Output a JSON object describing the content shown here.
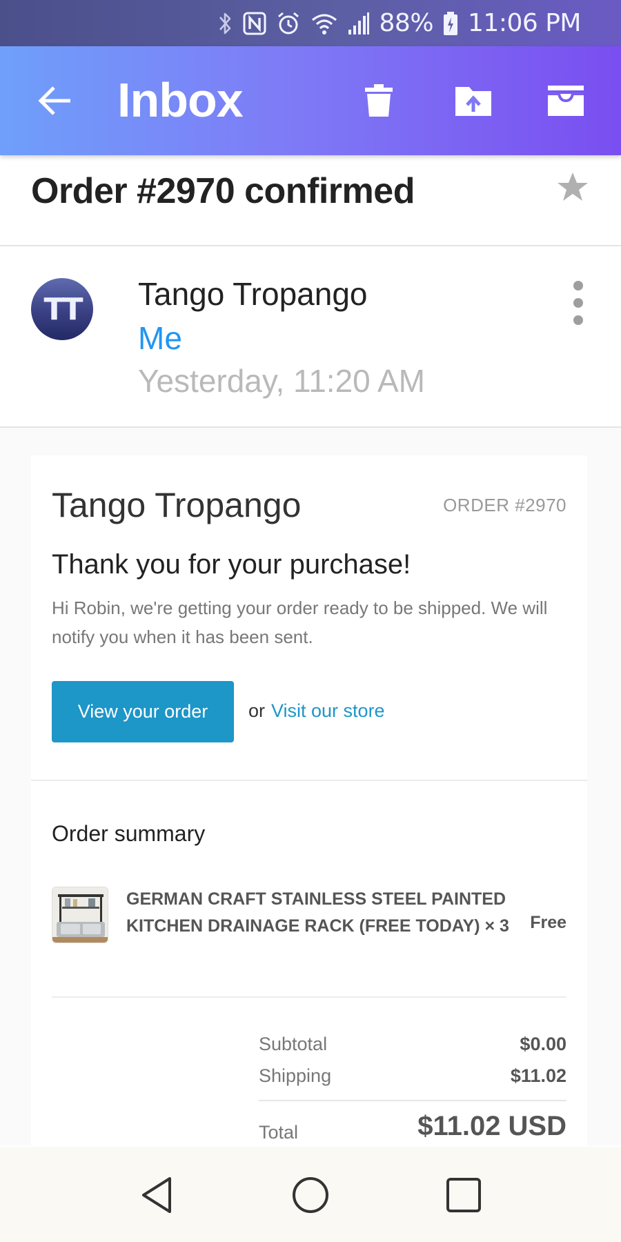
{
  "status_bar": {
    "battery": "88%",
    "time": "11:06 PM",
    "icons": [
      "bluetooth-icon",
      "nfc-icon",
      "alarm-icon",
      "wifi-icon",
      "signal-icon",
      "battery-icon"
    ]
  },
  "app_bar": {
    "title": "Inbox",
    "actions": [
      "back-arrow-icon",
      "delete-icon",
      "move-to-folder-icon",
      "archive-icon"
    ],
    "gradient": [
      "#6f9ffb",
      "#7a4ef0"
    ]
  },
  "email": {
    "subject": "Order #2970 confirmed",
    "starred": false,
    "sender": {
      "avatar_initials": "TT",
      "name": "Tango Tropango",
      "recipient": "Me",
      "date": "Yesterday, 11:20 AM"
    },
    "body": {
      "shop_name": "Tango Tropango",
      "order_tag": "ORDER #2970",
      "heading": "Thank you for your purchase!",
      "message": "Hi Robin, we're getting your order ready to be shipped. We will notify you when it has been sent.",
      "view_order_button": "View your order",
      "or_text": "or",
      "store_link": "Visit our store",
      "summary": {
        "title": "Order summary",
        "items": [
          {
            "name": "GERMAN CRAFT STAINLESS STEEL PAINTED KITCHEN DRAINAGE RACK (FREE TODAY) × 3",
            "price": "Free"
          }
        ],
        "subtotal_label": "Subtotal",
        "subtotal_value": "$0.00",
        "shipping_label": "Shipping",
        "shipping_value": "$11.02",
        "total_label": "Total",
        "total_value": "$11.02 USD"
      }
    }
  },
  "colors": {
    "link": "#1d96c8",
    "recipient": "#2196f3"
  },
  "nav_bar": [
    "back-triangle-icon",
    "home-circle-icon",
    "recents-square-icon"
  ]
}
